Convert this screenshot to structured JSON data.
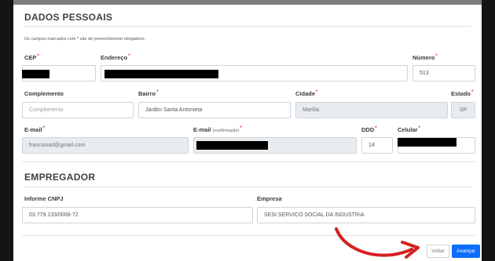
{
  "dados": {
    "title": "DADOS PESSOAIS",
    "note": "Os campos marcados com * são de preenchimento obrigatório.",
    "required_mark": "*",
    "cep_label": "CEP",
    "endereco_label": "Endereço",
    "numero_label": "Número",
    "numero_value": "513",
    "complemento_label": "Complemento",
    "complemento_placeholder": "Complemento",
    "bairro_label": "Bairro",
    "bairro_value": "Jardim Santa Antonieta",
    "cidade_label": "Cidade",
    "cidade_value": "Marília",
    "estado_label": "Estado",
    "estado_value": "SP",
    "email_label": "E-mail",
    "email_value": "francisoad@gmail.com",
    "email_conf_label": "E-mail",
    "email_conf_small": "(confirmação)",
    "ddd_label": "DDD",
    "ddd_value": "14",
    "celular_label": "Celular"
  },
  "empregador": {
    "title": "EMPREGADOR",
    "cnpj_label": "Informe CNPJ",
    "cnpj_value": "03.779.133/0008-72",
    "empresa_label": "Empresa",
    "empresa_value": "SESI SERVICO SOCIAL DA INDUSTRIA"
  },
  "actions": {
    "voltar": "Voltar",
    "avancar": "Avançar"
  },
  "colors": {
    "primary": "#0d6efd",
    "required": "#e03030",
    "arrow": "#d42020"
  }
}
